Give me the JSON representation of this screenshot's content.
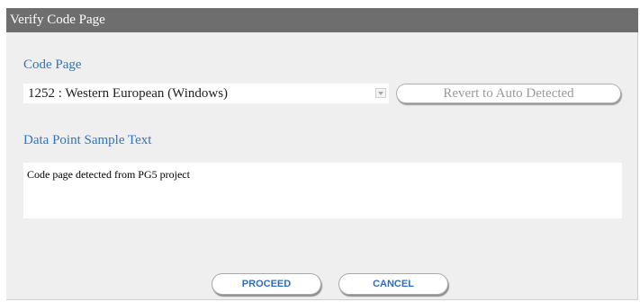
{
  "dialog": {
    "title": "Verify Code Page"
  },
  "code_page": {
    "label": "Code Page",
    "selected_value": "1252 : Western European (Windows)",
    "dropdown_icon": "chevron-down-icon",
    "revert_button_label": "Revert to Auto Detected"
  },
  "sample": {
    "label": "Data Point Sample Text",
    "text": "Code page detected from PG5 project"
  },
  "actions": {
    "proceed_label": "PROCEED",
    "cancel_label": "CANCEL"
  },
  "colors": {
    "title_bar": "#6e6e6e",
    "label_blue": "#2f73c5",
    "button_text": "#2f6cc0",
    "dialog_background": "#efefef"
  }
}
